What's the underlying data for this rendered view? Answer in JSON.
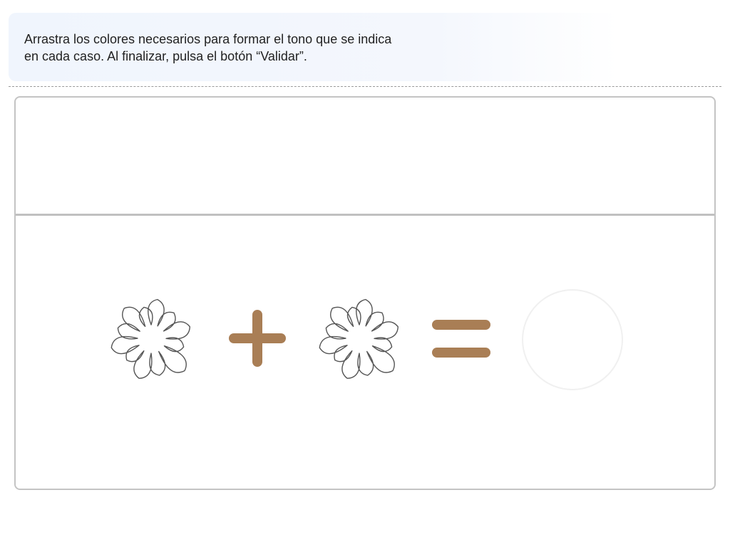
{
  "instructions": {
    "text": "Arrastra los colores necesarios para formar el tono que se indica\nen cada caso. Al finalizar, pulsa el botón “Validar”."
  },
  "equation": {
    "operator_plus_icon": "plus-icon",
    "operator_equals_icon": "equals-icon",
    "slot_icon": "paint-splash-outline-icon"
  },
  "colors": {
    "operator": "#a97e55",
    "outline": "#555555",
    "panel_border": "#c4c4c4"
  }
}
